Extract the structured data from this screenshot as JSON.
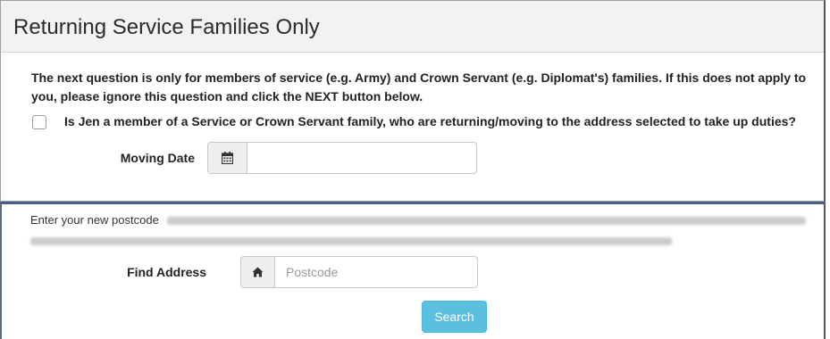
{
  "service_panel": {
    "title": "Returning Service Families Only",
    "info_text": "The next question is only for members of service (e.g. Army) and Crown Servant (e.g. Diplomat's) families. If this does not apply to you, please ignore this question and click the NEXT button below.",
    "checkbox_label": "Is Jen a member of a Service or Crown Servant family, who are returning/moving to the address selected to take up duties?",
    "moving_date_label": "Moving Date",
    "moving_date_value": "",
    "calendar_icon": "calendar-icon"
  },
  "address_panel": {
    "intro_text": "Enter your new postcode",
    "find_address_label": "Find Address",
    "postcode_placeholder": "Postcode",
    "home_icon": "home-icon",
    "search_label": "Search"
  },
  "colors": {
    "search_button": "#5bc0de",
    "divider": "#485f80"
  }
}
